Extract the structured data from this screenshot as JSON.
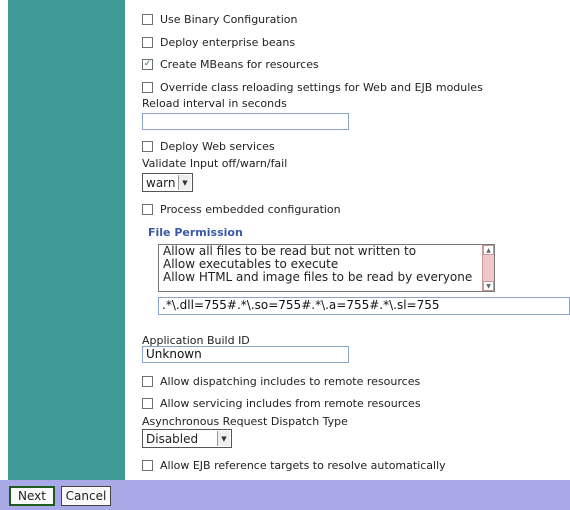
{
  "options": {
    "use_binary_config": {
      "label": "Use Binary Configuration",
      "checked": false
    },
    "deploy_ejb": {
      "label": "Deploy enterprise beans",
      "checked": false
    },
    "create_mbeans": {
      "label": "Create MBeans for resources",
      "checked": true
    },
    "override_reloading": {
      "label": "Override class reloading settings for Web and EJB modules",
      "checked": false
    },
    "deploy_ws": {
      "label": "Deploy Web services",
      "checked": false
    },
    "process_embedded": {
      "label": "Process embedded configuration",
      "checked": false
    },
    "allow_dispatching": {
      "label": "Allow dispatching includes to remote resources",
      "checked": false
    },
    "allow_servicing": {
      "label": "Allow servicing includes from remote resources",
      "checked": false
    },
    "allow_ejb_ref": {
      "label": "Allow EJB reference targets to resolve automatically",
      "checked": false
    }
  },
  "reload_interval": {
    "label": "Reload interval in seconds",
    "value": ""
  },
  "validate_input": {
    "label": "Validate Input off/warn/fail",
    "selected": "warn"
  },
  "file_permission": {
    "title": "File Permission",
    "items": [
      "Allow all files to be read but not written to",
      "Allow executables to execute",
      "Allow HTML and image files to be read by everyone"
    ],
    "value": ".*\\.dll=755#.*\\.so=755#.*\\.a=755#.*\\.sl=755"
  },
  "app_build_id": {
    "label": "Application Build ID",
    "value": "Unknown"
  },
  "async_dispatch": {
    "label": "Asynchronous Request Dispatch Type",
    "selected": "Disabled"
  },
  "buttons": {
    "next": "Next",
    "cancel": "Cancel"
  },
  "icons": {
    "check": "✓",
    "down_arrow": "▼",
    "up_arrow": "▲"
  }
}
